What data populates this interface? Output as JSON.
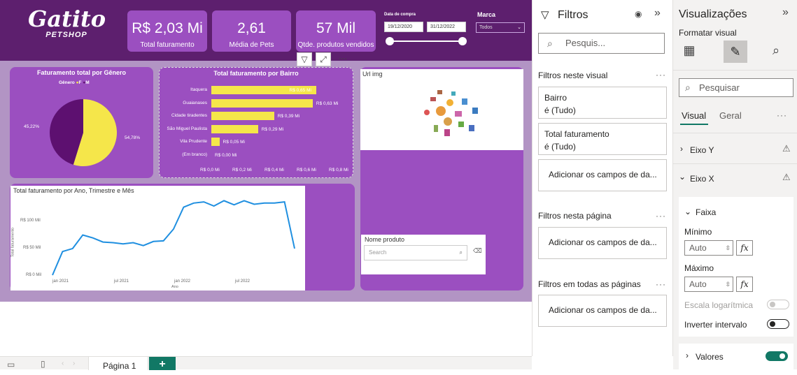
{
  "logo": {
    "name": "Gatito",
    "sub": "PETSHOP"
  },
  "kpis": [
    {
      "value": "R$ 2,03 Mi",
      "label": "Total faturamento"
    },
    {
      "value": "2,61",
      "label": "Média de Pets"
    },
    {
      "value": "57 Mil",
      "label": "Qtde. produtos vendidos"
    }
  ],
  "date_filter": {
    "label": "Data de compra",
    "start": "19/12/2020",
    "end": "31/12/2022"
  },
  "brand_filter": {
    "label": "Marca",
    "value": "Todos"
  },
  "pie": {
    "title": "Faturamento total por Gênero",
    "legend_title": "Gênero",
    "legend": [
      "F",
      "M"
    ],
    "colors": {
      "F": "#f5e64a",
      "M": "#5d1070"
    }
  },
  "bar_chart": {
    "title": "Total faturamento por Bairro",
    "x_ticks": [
      "R$ 0,0 Mi",
      "R$ 0,2 Mi",
      "R$ 0,4 Mi",
      "R$ 0,6 Mi",
      "R$ 0,8 Mi"
    ]
  },
  "line_chart": {
    "title": "Total faturamento por Ano, Trimestre e Mês",
    "ylabel": "Total faturamento",
    "xlabel": "Ano",
    "y_ticks": [
      "R$ 100 Mil",
      "R$ 50 Mil",
      "R$ 0 Mil"
    ],
    "x_ticks": [
      "jan 2021",
      "jul 2021",
      "jan 2022",
      "jul 2022"
    ]
  },
  "chart_data": [
    {
      "type": "pie",
      "title": "Faturamento total por Gênero",
      "labels": [
        "F",
        "M"
      ],
      "values": [
        54.78,
        45.22
      ],
      "data_labels": [
        "54,78%",
        "45,22%"
      ]
    },
    {
      "type": "bar",
      "title": "Total faturamento por Bairro",
      "categories": [
        "Itaquera",
        "Guaianases",
        "Cidade tiradentes",
        "São Miguel Paulista",
        "Vila Prudente",
        "(Em branco)"
      ],
      "values": [
        0.65,
        0.63,
        0.39,
        0.29,
        0.05,
        0.0
      ],
      "data_labels": [
        "R$ 0,65 Mi",
        "R$ 0,63 Mi",
        "R$ 0,39 Mi",
        "R$ 0,29 Mi",
        "R$ 0,05 Mi",
        "R$ 0,00 Mi"
      ],
      "xlim": [
        0,
        0.8
      ]
    },
    {
      "type": "line",
      "title": "Total faturamento por Ano, Trimestre e Mês",
      "xlabel": "Ano",
      "ylabel": "Total faturamento",
      "x": [
        "2020-12",
        "2021-01",
        "2021-02",
        "2021-03",
        "2021-04",
        "2021-05",
        "2021-06",
        "2021-07",
        "2021-08",
        "2021-09",
        "2021-10",
        "2021-11",
        "2021-12",
        "2022-01",
        "2022-02",
        "2022-03",
        "2022-04",
        "2022-05",
        "2022-06",
        "2022-07",
        "2022-08",
        "2022-09",
        "2022-10",
        "2022-11",
        "2022-12"
      ],
      "values": [
        0,
        40,
        45,
        68,
        63,
        56,
        55,
        53,
        55,
        50,
        57,
        58,
        78,
        115,
        122,
        124,
        117,
        126,
        119,
        126,
        120,
        122,
        122,
        124,
        45
      ],
      "ylim": [
        0,
        130
      ]
    }
  ],
  "url_img": {
    "title": "Url img"
  },
  "product": {
    "title": "Nome produto",
    "placeholder": "Search"
  },
  "filters": {
    "title": "Filtros",
    "search_placeholder": "Pesquis...",
    "visual_section": "Filtros neste visual",
    "cards": [
      {
        "name": "Bairro",
        "value": "é (Tudo)"
      },
      {
        "name": "Total faturamento",
        "value": "é (Tudo)"
      }
    ],
    "add_fields": "Adicionar os campos de da...",
    "page_section": "Filtros nesta página",
    "all_pages_section": "Filtros em todas as páginas"
  },
  "viz": {
    "title": "Visualizações",
    "subtitle": "Formatar visual",
    "search_placeholder": "Pesquisar",
    "tabs": [
      "Visual",
      "Geral"
    ],
    "sections": [
      "Eixo Y",
      "Eixo X"
    ],
    "faixa": "Faixa",
    "min_label": "Mínimo",
    "min_value": "Auto",
    "max_label": "Máximo",
    "max_value": "Auto",
    "log_label": "Escala logarítmica",
    "invert_label": "Inverter intervalo",
    "values_label": "Valores",
    "fx": "fx"
  },
  "page_tab": "Página 1",
  "add_page": "+"
}
